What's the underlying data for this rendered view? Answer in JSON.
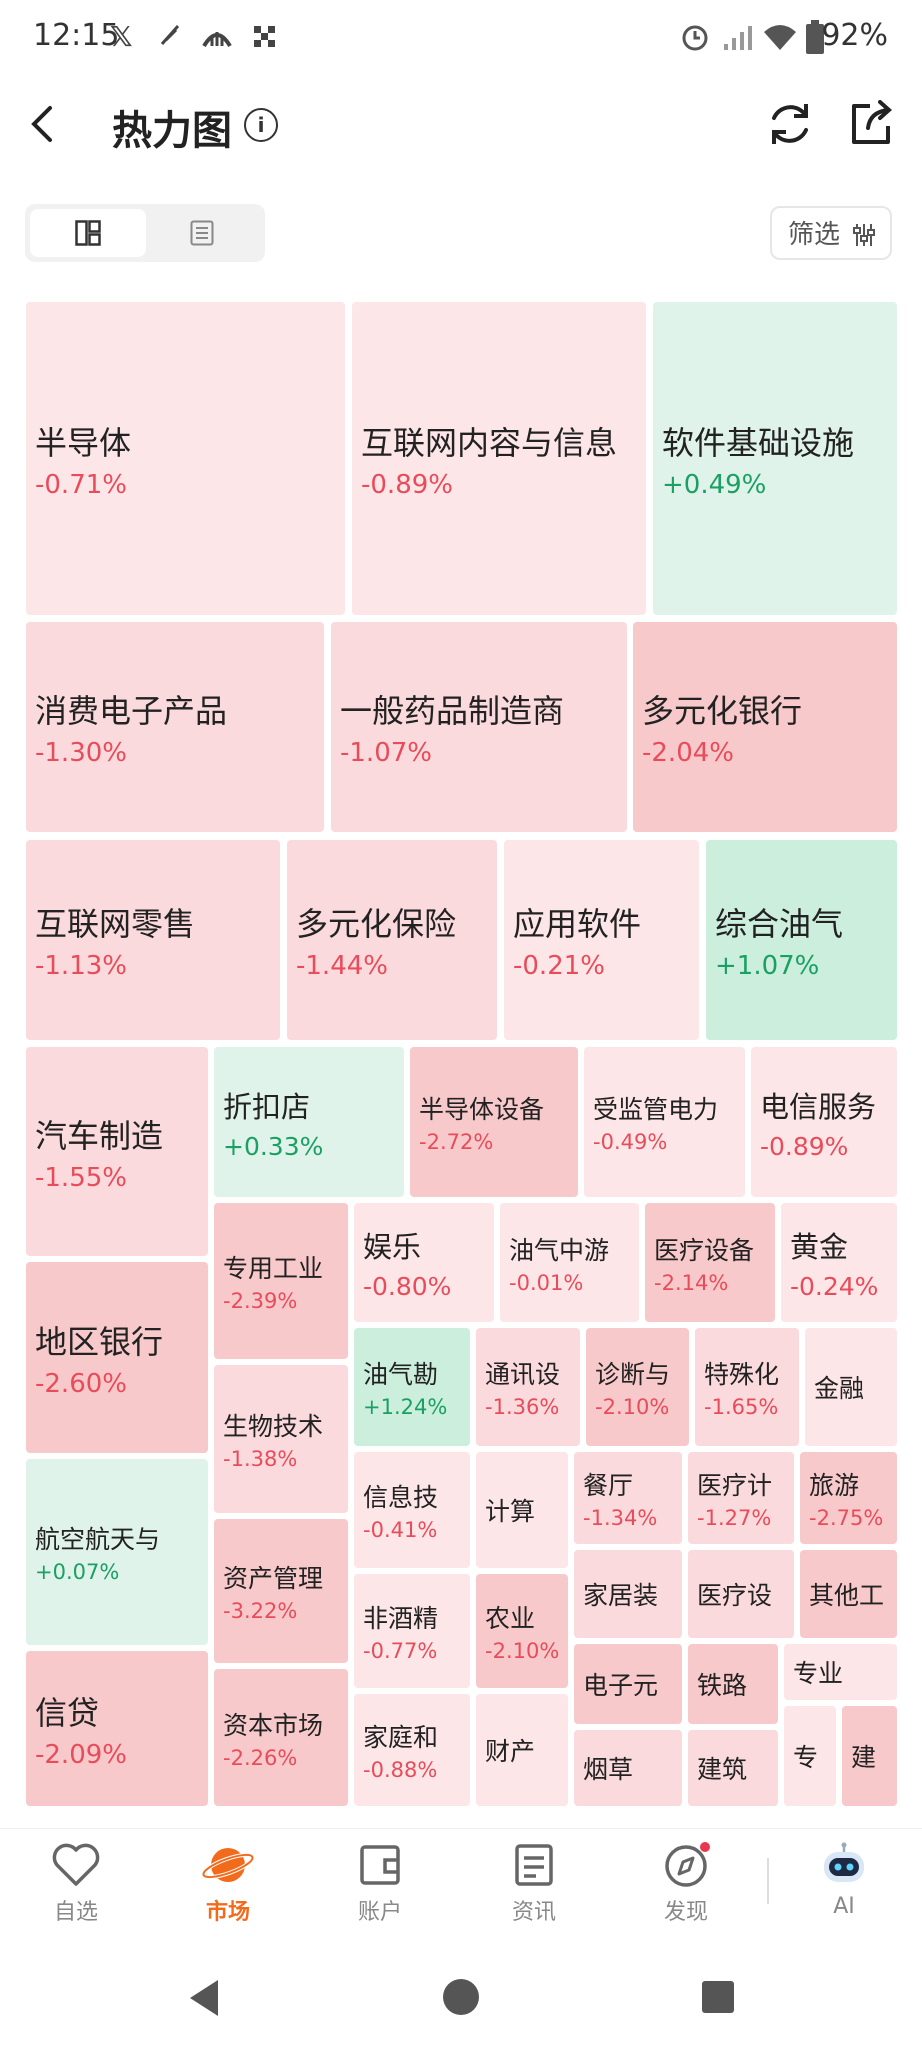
{
  "status_bar": {
    "time": "12:15",
    "icons": [
      "x-icon",
      "feather-icon",
      "bridge-icon",
      "grid-icon"
    ],
    "battery": "92%",
    "right_icons": [
      "alarm-icon",
      "signal-icon",
      "wifi-icon",
      "battery-icon"
    ]
  },
  "header": {
    "title": "热力图",
    "info": "i"
  },
  "toolbar": {
    "filter_label": "筛选"
  },
  "heatmap": [
    {
      "name": "半导体",
      "change": "-0.71%"
    },
    {
      "name": "互联网内容与信息",
      "change": "-0.89%"
    },
    {
      "name": "软件基础设施",
      "change": "+0.49%"
    },
    {
      "name": "消费电子产品",
      "change": "-1.30%"
    },
    {
      "name": "一般药品制造商",
      "change": "-1.07%"
    },
    {
      "name": "多元化银行",
      "change": "-2.04%"
    },
    {
      "name": "互联网零售",
      "change": "-1.13%"
    },
    {
      "name": "多元化保险",
      "change": "-1.44%"
    },
    {
      "name": "应用软件",
      "change": "-0.21%"
    },
    {
      "name": "综合油气",
      "change": "+1.07%"
    },
    {
      "name": "汽车制造",
      "change": "-1.55%"
    },
    {
      "name": "折扣店",
      "change": "+0.33%"
    },
    {
      "name": "半导体设备",
      "change": "-2.72%"
    },
    {
      "name": "受监管电力",
      "change": "-0.49%"
    },
    {
      "name": "电信服务",
      "change": "-0.89%"
    },
    {
      "name": "专用工业",
      "change": "-2.39%"
    },
    {
      "name": "娱乐",
      "change": "-0.80%"
    },
    {
      "name": "油气中游",
      "change": "-0.01%"
    },
    {
      "name": "医疗设备",
      "change": "-2.14%"
    },
    {
      "name": "黄金",
      "change": "-0.24%"
    },
    {
      "name": "地区银行",
      "change": "-2.60%"
    },
    {
      "name": "生物技术",
      "change": "-1.38%"
    },
    {
      "name": "油气勘",
      "change": "+1.24%"
    },
    {
      "name": "通讯设",
      "change": "-1.36%"
    },
    {
      "name": "诊断与",
      "change": "-2.10%"
    },
    {
      "name": "特殊化",
      "change": "-1.65%"
    },
    {
      "name": "金融",
      "change": ""
    },
    {
      "name": "航空航天与",
      "change": "+0.07%"
    },
    {
      "name": "资产管理",
      "change": "-3.22%"
    },
    {
      "name": "信息技",
      "change": "-0.41%"
    },
    {
      "name": "计算",
      "change": ""
    },
    {
      "name": "餐厅",
      "change": "-1.34%"
    },
    {
      "name": "医疗计",
      "change": "-1.27%"
    },
    {
      "name": "旅游",
      "change": "-2.75%"
    },
    {
      "name": "非酒精",
      "change": "-0.77%"
    },
    {
      "name": "农业",
      "change": "-2.10%"
    },
    {
      "name": "家居装",
      "change": ""
    },
    {
      "name": "医疗设",
      "change": ""
    },
    {
      "name": "其他工",
      "change": ""
    },
    {
      "name": "信贷",
      "change": "-2.09%"
    },
    {
      "name": "资本市场",
      "change": "-2.26%"
    },
    {
      "name": "家庭和",
      "change": "-0.88%"
    },
    {
      "name": "财产",
      "change": ""
    },
    {
      "name": "电子元",
      "change": ""
    },
    {
      "name": "铁路",
      "change": ""
    },
    {
      "name": "专业",
      "change": ""
    },
    {
      "name": "烟草",
      "change": ""
    },
    {
      "name": "建筑",
      "change": ""
    },
    {
      "name": "专",
      "change": ""
    },
    {
      "name": "建",
      "change": ""
    }
  ],
  "bottom_nav": [
    {
      "label": "自选",
      "icon": "heart-icon"
    },
    {
      "label": "市场",
      "icon": "planet-icon"
    },
    {
      "label": "账户",
      "icon": "wallet-icon"
    },
    {
      "label": "资讯",
      "icon": "news-icon"
    },
    {
      "label": "发现",
      "icon": "compass-icon"
    },
    {
      "label": "AI",
      "icon": "robot-icon"
    }
  ],
  "colors": {
    "accent": "#f26b1d",
    "negative": "#e84c5a",
    "positive": "#1aa063"
  }
}
